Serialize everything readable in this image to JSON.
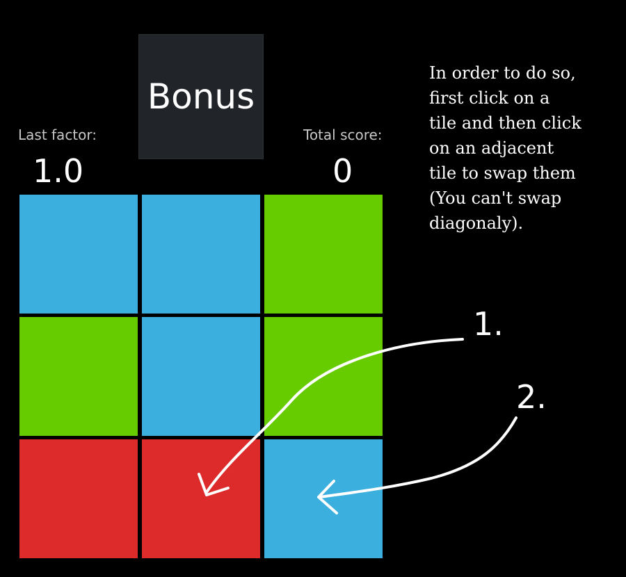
{
  "stats": {
    "last_factor_label": "Last factor:",
    "last_factor_value": "1.0",
    "total_score_label": "Total score:",
    "total_score_value": "0"
  },
  "bonus_label": "Bonus",
  "instructions": [
    "In order to do so,",
    "first click on a",
    "tile and then click",
    "on an adjacent",
    "tile to swap them",
    "(You can't swap",
    "diagonaly)."
  ],
  "board": {
    "rows": [
      [
        "blue",
        "blue",
        "green"
      ],
      [
        "green",
        "blue",
        "green"
      ],
      [
        "red",
        "red",
        "blue"
      ]
    ]
  },
  "colors": {
    "blue": "#3bb0de",
    "green": "#66cc00",
    "red": "#dd2a2a"
  },
  "annotations": {
    "step1": "1.",
    "step2": "2."
  }
}
